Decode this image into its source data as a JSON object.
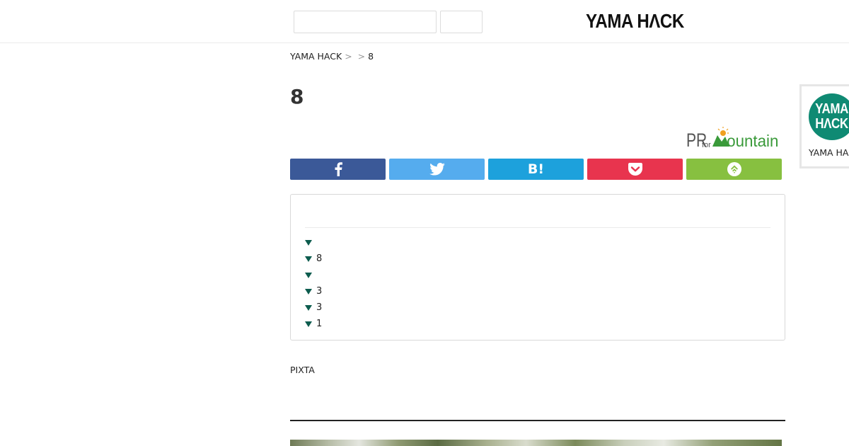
{
  "header": {
    "logo_text": "YAMA HΛCK",
    "search_placeholder": ""
  },
  "breadcrumb": {
    "items": [
      {
        "label": "YAMA HACK"
      },
      {
        "label": ""
      },
      {
        "label": "8"
      }
    ],
    "separator": ">"
  },
  "article": {
    "title": "8",
    "sponsor_logo_text": "PR for Mountain",
    "source_credit": "PIXTA"
  },
  "share": {
    "buttons": [
      {
        "name": "facebook",
        "icon": "facebook-icon",
        "color": "#3b5998"
      },
      {
        "name": "twitter",
        "icon": "twitter-icon",
        "color": "#55acee"
      },
      {
        "name": "hatena",
        "icon": "hatena-bookmark-icon",
        "label": "B!",
        "color": "#1da1dc"
      },
      {
        "name": "pocket",
        "icon": "pocket-icon",
        "color": "#e8344e"
      },
      {
        "name": "feedly",
        "icon": "feedly-icon",
        "color": "#87c040"
      }
    ]
  },
  "toc": {
    "title": "",
    "items": [
      {
        "label": ""
      },
      {
        "label": "8"
      },
      {
        "label": ""
      },
      {
        "label": "3"
      },
      {
        "label": "3"
      },
      {
        "label": "1"
      }
    ],
    "arrow_color": "#0d5c4e"
  },
  "sidebar": {
    "avatar_text": "YAMA HΛCK",
    "author_name": "YAMA HACK"
  },
  "colors": {
    "brand_green": "#0f8a73",
    "divider": "#ebebeb"
  }
}
